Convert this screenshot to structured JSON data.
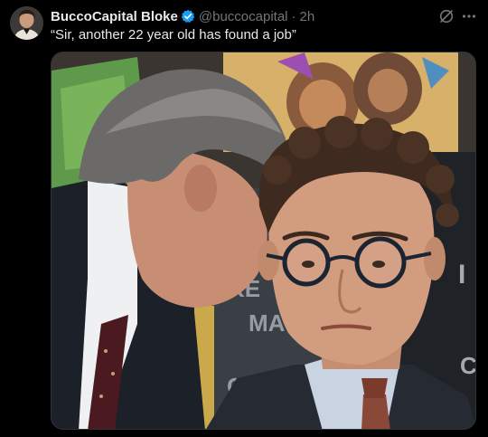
{
  "tweet": {
    "display_name": "BuccoCapital Bloke",
    "handle": "@buccocapital",
    "separator": "·",
    "time": "2h",
    "text": "“Sir, another 22 year old has found a job”"
  },
  "icons": {
    "verified": "verified-badge-icon",
    "grok": "grok-icon",
    "more": "more-options-icon"
  },
  "colors": {
    "background": "#000000",
    "primary_text": "#e7e9ea",
    "secondary_text": "#71767b",
    "verified_blue": "#1d9bf0"
  },
  "media": {
    "board_text_lines": [
      "KE",
      "MA",
      "CO"
    ],
    "board_edge_letter": "I",
    "board_edge_letter_2": "C"
  }
}
